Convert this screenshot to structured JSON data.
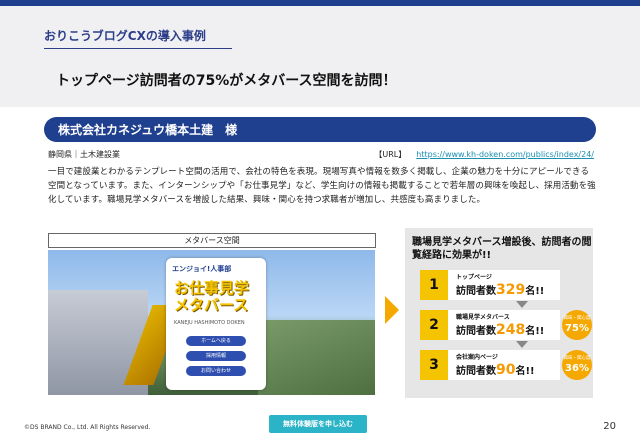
{
  "section_title": "おりこうブログCXの導入事例",
  "headline": "トップページ訪問者の75%がメタバース空間を訪問！",
  "company": "株式会社カネジュウ橋本土建　様",
  "meta": {
    "location": "静岡県｜土木建設業",
    "url_label": "【URL】",
    "url": "https://www.kh-doken.com/publics/index/24/"
  },
  "body": "一目で建設業とわかるテンプレート空間の活用で、会社の特色を表現。現場写真や情報を数多く掲載し、企業の魅力を十分にアピールできる空間となっています。また、インターンシップや「お仕事見学」など、学生向けの情報も掲載することで若年層の興味を喚起し、採用活動を強化しています。職場見学メタバースを増設した結果、興味・関心を持つ求職者が増加し、共感度も高まりました。",
  "image_label": "メタバース空間",
  "screenshot": {
    "card_top": "エンジョイ!人事部",
    "card_title": "お仕事見学メタバース",
    "card_sub": "KANEJU HASHIMOTO DOKEN",
    "btn1": "ホームへ戻る",
    "btn2": "採用情報",
    "btn3": "お問い合わせ"
  },
  "results": {
    "title": "職場見学メタバース増設後、訪問者の閲覧経路に効果が!!",
    "rows": [
      {
        "num": "1",
        "label": "トップページ",
        "prefix": "訪問者数",
        "value": "329",
        "suffix": "名!!"
      },
      {
        "num": "2",
        "label": "職場見学メタバース",
        "prefix": "訪問者数",
        "value": "248",
        "suffix": "名!!"
      },
      {
        "num": "3",
        "label": "会社案内ページ",
        "prefix": "訪問者数",
        "value": "90",
        "suffix": "名!!"
      }
    ],
    "badges": [
      {
        "label": "興味・関心度",
        "value": "75%"
      },
      {
        "label": "興味・関心度",
        "value": "36%"
      }
    ]
  },
  "footer": {
    "copyright": "©DS BRAND Co., Ltd. All Rights Reserved.",
    "cta": "無料体験版を申し込む",
    "page": "20"
  }
}
